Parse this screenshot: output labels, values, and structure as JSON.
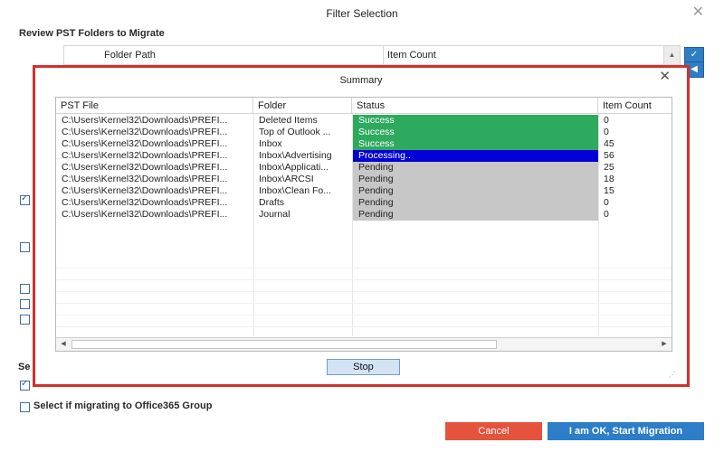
{
  "outer": {
    "title": "Filter Selection",
    "review_label": "Review PST Folders to Migrate",
    "columns": {
      "folder_path": "Folder Path",
      "item_count": "Item Count"
    },
    "section_label": "Se",
    "o365_label": "Select if migrating to Office365 Group",
    "cancel_label": "Cancel",
    "ok_label": "I am OK, Start Migration"
  },
  "summary": {
    "title": "Summary",
    "close": "✕",
    "columns": {
      "pst_file": "PST File",
      "folder": "Folder",
      "status": "Status",
      "item_count": "Item Count"
    },
    "rows": [
      {
        "file": "C:\\Users\\Kernel32\\Downloads\\PREFI...",
        "folder": "Deleted Items",
        "status": "Success",
        "count": "0"
      },
      {
        "file": "C:\\Users\\Kernel32\\Downloads\\PREFI...",
        "folder": "Top of Outlook ...",
        "status": "Success",
        "count": "0"
      },
      {
        "file": "C:\\Users\\Kernel32\\Downloads\\PREFI...",
        "folder": "Inbox",
        "status": "Success",
        "count": "45"
      },
      {
        "file": "C:\\Users\\Kernel32\\Downloads\\PREFI...",
        "folder": "Inbox\\Advertising",
        "status": "Processing..",
        "count": "56"
      },
      {
        "file": "C:\\Users\\Kernel32\\Downloads\\PREFI...",
        "folder": "Inbox\\Applicati...",
        "status": "Pending",
        "count": "25"
      },
      {
        "file": "C:\\Users\\Kernel32\\Downloads\\PREFI...",
        "folder": "Inbox\\ARCSI",
        "status": "Pending",
        "count": "18"
      },
      {
        "file": "C:\\Users\\Kernel32\\Downloads\\PREFI...",
        "folder": "Inbox\\Clean Fo...",
        "status": "Pending",
        "count": "15"
      },
      {
        "file": "C:\\Users\\Kernel32\\Downloads\\PREFI...",
        "folder": "Drafts",
        "status": "Pending",
        "count": "0"
      },
      {
        "file": "C:\\Users\\Kernel32\\Downloads\\PREFI...",
        "folder": "Journal",
        "status": "Pending",
        "count": "0"
      }
    ],
    "stop_label": "Stop"
  },
  "colors": {
    "success": "#2eaa5e",
    "processing": "#0000d6",
    "pending": "#c7c7c7",
    "highlight_border": "#d0312d",
    "cancel": "#e5533d",
    "primary": "#2c7ec8"
  },
  "icons": {
    "outer_close": "close-icon",
    "scroll_up": "chevron-up-icon",
    "select_all": "check-list-icon",
    "collapse": "collapse-icon",
    "scroll_left": "chevron-left-icon",
    "scroll_right": "chevron-right-icon",
    "resize_grip": "resize-grip-icon"
  }
}
